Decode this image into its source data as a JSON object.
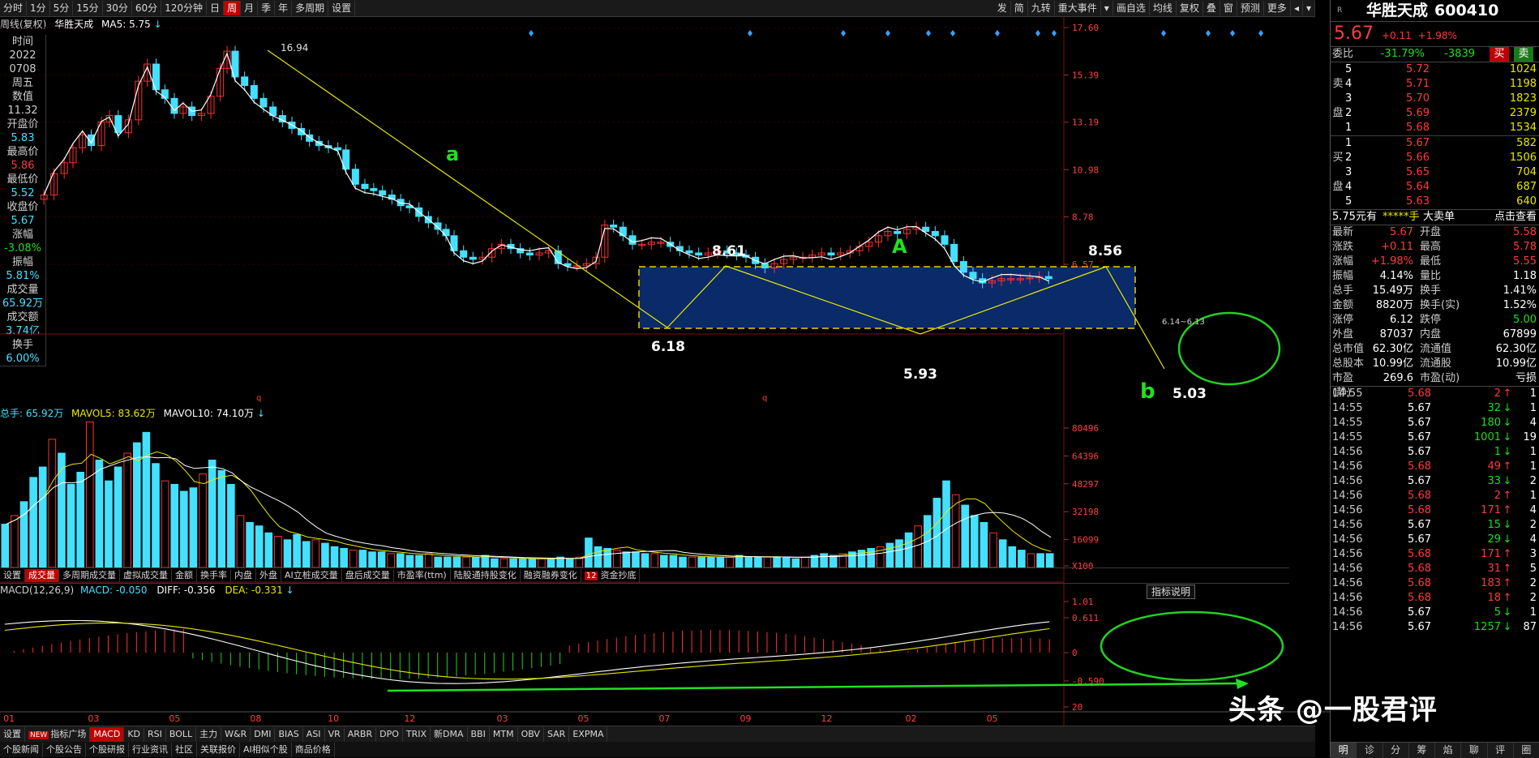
{
  "toolbar": {
    "periods": [
      "分时",
      "1分",
      "5分",
      "15分",
      "30分",
      "60分",
      "120分钟",
      "日",
      "周",
      "月",
      "季",
      "年",
      "多周期",
      "设置"
    ],
    "active_index": 8,
    "right_tools": [
      "发",
      "简",
      "九转",
      "重大事件",
      "▾",
      "画自选",
      "均线",
      "复权",
      "叠",
      "窗",
      "预测",
      "更多",
      "◂",
      "▾"
    ]
  },
  "chart_header": {
    "mode": "周线(复权)",
    "name": "华胜天成",
    "ma": "MA5: 5.75",
    "ma_arrow": "↓"
  },
  "left_info": [
    {
      "label": "时间",
      "value": "2022"
    },
    {
      "label": "",
      "value": "0708"
    },
    {
      "label": "周五",
      "value": ""
    },
    {
      "label": "数值",
      "value": "11.32"
    },
    {
      "label": "开盘价",
      "value": "5.83"
    },
    {
      "label": "最高价",
      "value": "5.86"
    },
    {
      "label": "最低价",
      "value": "5.52"
    },
    {
      "label": "收盘价",
      "value": "5.67"
    },
    {
      "label": "涨幅",
      "value": "-3.08%"
    },
    {
      "label": "振幅",
      "value": "5.81%"
    },
    {
      "label": "成交量",
      "value": "65.92万"
    },
    {
      "label": "成交额",
      "value": "3.74亿"
    },
    {
      "label": "换手",
      "value": "6.00%"
    }
  ],
  "price_axis": [
    "17.60",
    "15.39",
    "13.19",
    "10.98",
    "8.78",
    "6.57"
  ],
  "annotations": {
    "high": "16.94",
    "a": "a",
    "A": "A",
    "p1": "8.61",
    "p2": "8.56",
    "low1": "6.18",
    "low2": "5.93",
    "b": "b",
    "low3": "5.03",
    "range": "6.14~6.13",
    "q1": "q",
    "q2": "q"
  },
  "vol_header": {
    "total": "总手: 65.92万",
    "mavol5": "MAVOL5: 83.62万",
    "mavol10": "MAVOL10: 74.10万",
    "arrow": "↓"
  },
  "vol_axis": [
    "80496",
    "64396",
    "48297",
    "32198",
    "16099",
    "X100"
  ],
  "vol_tabs": [
    "设置",
    "成交量",
    "多周期成交量",
    "虚拟成交量",
    "金额",
    "换手率",
    "内盘",
    "外盘",
    "AI立桩成交量",
    "盘后成交量",
    "市盈率(ttm)",
    "陆股通持股变化",
    "融资融券变化",
    "资金抄底"
  ],
  "vol_tab_badge": "12",
  "macd_header": {
    "label": "MACD(12,26,9)",
    "macd": "MACD: -0.050",
    "diff": "DIFF: -0.356",
    "dea": "DEA: -0.331",
    "arrow": "↓",
    "btn": "指标说明"
  },
  "macd_axis": [
    "1.01",
    "0.611",
    "0",
    "-0.590",
    "20"
  ],
  "x_axis": [
    "01",
    "03",
    "05",
    "08",
    "10",
    "12",
    "03",
    "05",
    "07",
    "09",
    "12",
    "02",
    "05"
  ],
  "indicator_tabs": [
    "设置",
    "指标广场",
    "MACD",
    "KD",
    "RSI",
    "BOLL",
    "主力",
    "W&R",
    "DMI",
    "BIAS",
    "ASI",
    "VR",
    "ARBR",
    "DPO",
    "TRIX",
    "新DMA",
    "BBI",
    "MTM",
    "OBV",
    "SAR",
    "EXPMA"
  ],
  "new_badge": "NEW",
  "bottom_links": [
    "个股新闻",
    "个股公告",
    "个股研报",
    "行业资讯",
    "社区",
    "关联报价",
    "AI相似个股",
    "商品价格"
  ],
  "quote": {
    "name": "华胜天成",
    "code": "600410",
    "price": "5.67",
    "chg": "+0.11",
    "pct": "+1.98%",
    "webi_label": "委比",
    "webi": "-31.79%",
    "webi2": "-3839",
    "buy_btn": "买",
    "sell_btn": "卖",
    "sell_label": [
      "卖",
      "盘"
    ],
    "buy_label": [
      "买",
      "盘"
    ],
    "sells": [
      {
        "n": "5",
        "p": "5.72",
        "v": "1024"
      },
      {
        "n": "4",
        "p": "5.71",
        "v": "1198"
      },
      {
        "n": "3",
        "p": "5.70",
        "v": "1823"
      },
      {
        "n": "2",
        "p": "5.69",
        "v": "2379"
      },
      {
        "n": "1",
        "p": "5.68",
        "v": "1534"
      }
    ],
    "buys": [
      {
        "n": "1",
        "p": "5.67",
        "v": "582"
      },
      {
        "n": "2",
        "p": "5.66",
        "v": "1506"
      },
      {
        "n": "3",
        "p": "5.65",
        "v": "704"
      },
      {
        "n": "4",
        "p": "5.64",
        "v": "687"
      },
      {
        "n": "5",
        "p": "5.63",
        "v": "640"
      }
    ],
    "order_left": "5.75元有",
    "order_mid": "*****手",
    "order_big": "大卖单",
    "order_link": "点击查看",
    "stats": [
      [
        "最新",
        "5.67",
        "开盘",
        "5.58"
      ],
      [
        "涨跌",
        "+0.11",
        "最高",
        "5.78"
      ],
      [
        "涨幅",
        "+1.98%",
        "最低",
        "5.55"
      ],
      [
        "振幅",
        "4.14%",
        "量比",
        "1.18"
      ],
      [
        "总手",
        "15.49万",
        "换手",
        "1.41%"
      ],
      [
        "金额",
        "8820万",
        "换手(实)",
        "1.52%"
      ],
      [
        "涨停",
        "6.12",
        "跌停",
        "5.00"
      ],
      [
        "外盘",
        "87037",
        "内盘",
        "67899"
      ],
      [
        "总市值",
        "62.30亿",
        "流通值",
        "62.30亿"
      ],
      [
        "总股本",
        "10.99亿",
        "流通股",
        "10.99亿"
      ],
      [
        "市盈(静)",
        "269.6",
        "市盈(动)",
        "亏损"
      ]
    ],
    "ticks": [
      [
        "14:55",
        "5.68",
        "2",
        "1"
      ],
      [
        "14:55",
        "5.67",
        "32",
        "1"
      ],
      [
        "14:55",
        "5.67",
        "180",
        "4"
      ],
      [
        "14:55",
        "5.67",
        "1001",
        "19"
      ],
      [
        "14:56",
        "5.67",
        "1",
        "1"
      ],
      [
        "14:56",
        "5.68",
        "49",
        "1"
      ],
      [
        "14:56",
        "5.67",
        "33",
        "2"
      ],
      [
        "14:56",
        "5.68",
        "2",
        "1"
      ],
      [
        "14:56",
        "5.68",
        "171",
        "4"
      ],
      [
        "14:56",
        "5.67",
        "15",
        "2"
      ],
      [
        "14:56",
        "5.67",
        "29",
        "4"
      ],
      [
        "14:56",
        "5.68",
        "171",
        "3"
      ],
      [
        "14:56",
        "5.68",
        "31",
        "5"
      ],
      [
        "14:56",
        "5.68",
        "183",
        "2"
      ],
      [
        "14:56",
        "5.68",
        "18",
        "2"
      ],
      [
        "14:56",
        "5.67",
        "5",
        "1"
      ],
      [
        "14:56",
        "5.67",
        "1257",
        "87"
      ]
    ],
    "bottom_tabs": [
      "明",
      "诊",
      "分",
      "筹",
      "焰",
      "聊",
      "评",
      "圈"
    ],
    "r_mark": "R"
  },
  "watermark": "头条 @一股君评"
}
